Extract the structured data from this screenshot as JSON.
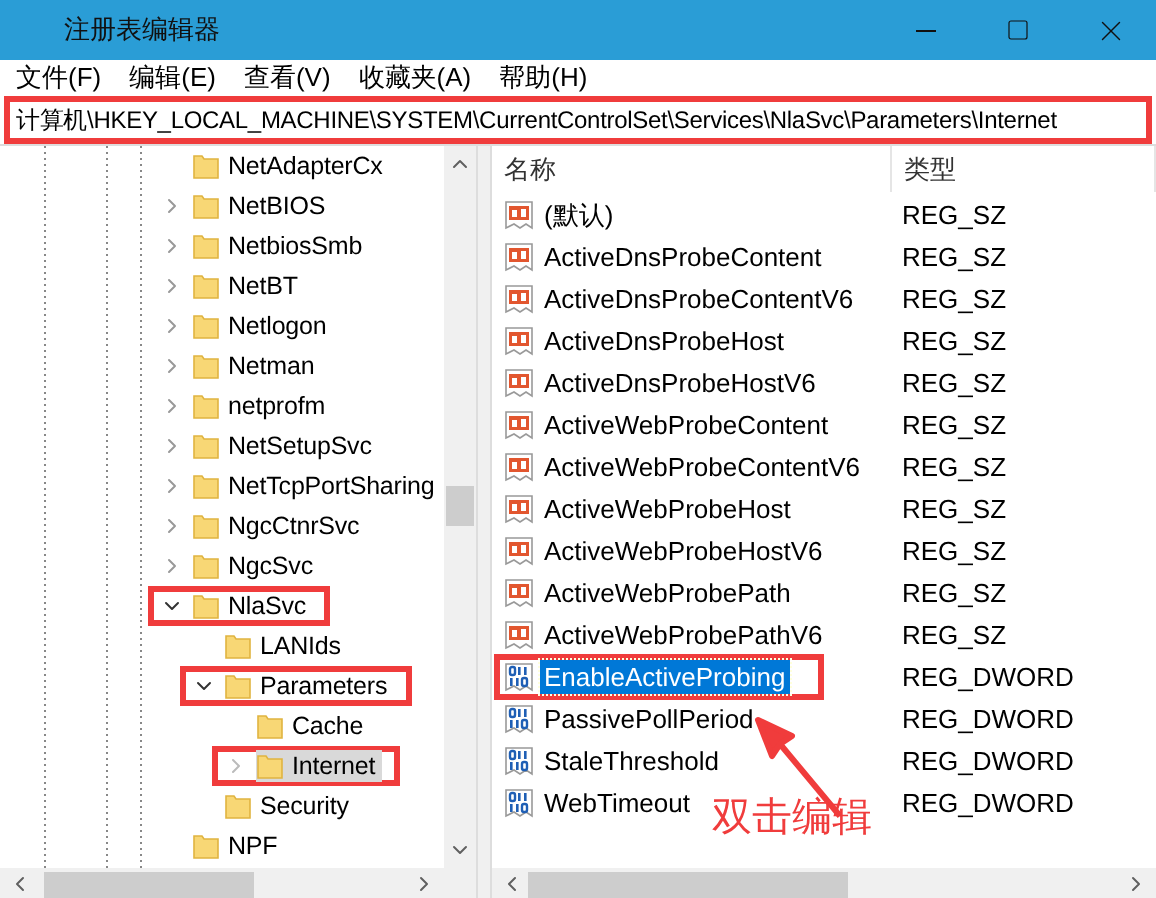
{
  "window": {
    "title": "注册表编辑器"
  },
  "menu": [
    "文件(F)",
    "编辑(E)",
    "查看(V)",
    "收藏夹(A)",
    "帮助(H)"
  ],
  "address": {
    "value": "计算机\\HKEY_LOCAL_MACHINE\\SYSTEM\\CurrentControlSet\\Services\\NlaSvc\\Parameters\\Internet",
    "annotated": true
  },
  "tree": [
    {
      "label": "NetAdapterCx",
      "kind": "leaf",
      "selected": false,
      "annotated": false
    },
    {
      "label": "NetBIOS",
      "kind": "branch",
      "expanded": false,
      "selected": false,
      "annotated": false
    },
    {
      "label": "NetbiosSmb",
      "kind": "branch",
      "expanded": false,
      "selected": false,
      "annotated": false
    },
    {
      "label": "NetBT",
      "kind": "branch",
      "expanded": false,
      "selected": false,
      "annotated": false
    },
    {
      "label": "Netlogon",
      "kind": "branch",
      "expanded": false,
      "selected": false,
      "annotated": false
    },
    {
      "label": "Netman",
      "kind": "branch",
      "expanded": false,
      "selected": false,
      "annotated": false
    },
    {
      "label": "netprofm",
      "kind": "branch",
      "expanded": false,
      "selected": false,
      "annotated": false
    },
    {
      "label": "NetSetupSvc",
      "kind": "branch",
      "expanded": false,
      "selected": false,
      "annotated": false
    },
    {
      "label": "NetTcpPortSharing",
      "kind": "branch",
      "expanded": false,
      "selected": false,
      "annotated": false
    },
    {
      "label": "NgcCtnrSvc",
      "kind": "branch",
      "expanded": false,
      "selected": false,
      "annotated": false
    },
    {
      "label": "NgcSvc",
      "kind": "branch",
      "expanded": false,
      "selected": false,
      "annotated": false
    },
    {
      "label": "NlaSvc",
      "kind": "branch",
      "expanded": true,
      "selected": false,
      "annotated": true,
      "children": [
        {
          "label": "LANIds",
          "kind": "leaf",
          "selected": false,
          "annotated": false
        },
        {
          "label": "Parameters",
          "kind": "branch",
          "expanded": true,
          "selected": false,
          "annotated": true,
          "children": [
            {
              "label": "Cache",
              "kind": "leaf",
              "selected": false,
              "annotated": false
            },
            {
              "label": "Internet",
              "kind": "branch",
              "expanded": false,
              "selected": true,
              "annotated": true
            }
          ]
        },
        {
          "label": "Security",
          "kind": "leaf",
          "selected": false,
          "annotated": false
        }
      ]
    },
    {
      "label": "NPF",
      "kind": "leaf",
      "selected": false,
      "annotated": false
    }
  ],
  "values": {
    "columns": [
      "名称",
      "类型"
    ],
    "rows": [
      {
        "name": "(默认)",
        "type": "REG_SZ",
        "kind": "string",
        "selected": false,
        "annotated": false
      },
      {
        "name": "ActiveDnsProbeContent",
        "type": "REG_SZ",
        "kind": "string",
        "selected": false,
        "annotated": false
      },
      {
        "name": "ActiveDnsProbeContentV6",
        "type": "REG_SZ",
        "kind": "string",
        "selected": false,
        "annotated": false
      },
      {
        "name": "ActiveDnsProbeHost",
        "type": "REG_SZ",
        "kind": "string",
        "selected": false,
        "annotated": false
      },
      {
        "name": "ActiveDnsProbeHostV6",
        "type": "REG_SZ",
        "kind": "string",
        "selected": false,
        "annotated": false
      },
      {
        "name": "ActiveWebProbeContent",
        "type": "REG_SZ",
        "kind": "string",
        "selected": false,
        "annotated": false
      },
      {
        "name": "ActiveWebProbeContentV6",
        "type": "REG_SZ",
        "kind": "string",
        "selected": false,
        "annotated": false
      },
      {
        "name": "ActiveWebProbeHost",
        "type": "REG_SZ",
        "kind": "string",
        "selected": false,
        "annotated": false
      },
      {
        "name": "ActiveWebProbeHostV6",
        "type": "REG_SZ",
        "kind": "string",
        "selected": false,
        "annotated": false
      },
      {
        "name": "ActiveWebProbePath",
        "type": "REG_SZ",
        "kind": "string",
        "selected": false,
        "annotated": false
      },
      {
        "name": "ActiveWebProbePathV6",
        "type": "REG_SZ",
        "kind": "string",
        "selected": false,
        "annotated": false
      },
      {
        "name": "EnableActiveProbing",
        "type": "REG_DWORD",
        "kind": "dword",
        "selected": true,
        "annotated": true
      },
      {
        "name": "PassivePollPeriod",
        "type": "REG_DWORD",
        "kind": "dword",
        "selected": false,
        "annotated": false
      },
      {
        "name": "StaleThreshold",
        "type": "REG_DWORD",
        "kind": "dword",
        "selected": false,
        "annotated": false
      },
      {
        "name": "WebTimeout",
        "type": "REG_DWORD",
        "kind": "dword",
        "selected": false,
        "annotated": false
      }
    ]
  },
  "annotation": {
    "text": "双击编辑"
  }
}
